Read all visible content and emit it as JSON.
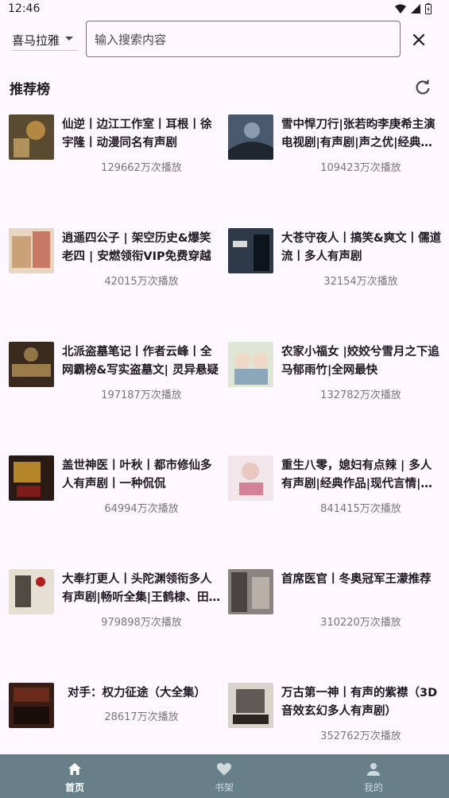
{
  "status_bar": {
    "time": "12:46"
  },
  "search": {
    "source": "喜马拉雅",
    "placeholder": "输入搜索内容"
  },
  "section": {
    "title": "推荐榜"
  },
  "books": [
    {
      "title": "仙逆丨边江工作室丨耳根丨徐宇隆丨动漫同名有声剧",
      "plays": "129662万次播放",
      "cover_color": "#5a4a2f"
    },
    {
      "title": "雪中悍刀行|张若昀李庚希主演电视剧|有声剧|声之优|经典作品",
      "plays": "109423万次播放",
      "cover_color": "#4a5a6e"
    },
    {
      "title": "逍遥四公子 | 架空历史&爆笑老四 | 安燃领衔VIP免费穿越",
      "plays": "42015万次播放",
      "cover_color": "#c9a27a"
    },
    {
      "title": "大苍守夜人丨搞笑&爽文丨儒道流丨多人有声剧",
      "plays": "32154万次播放",
      "cover_color": "#2e3a4a"
    },
    {
      "title": "北派盗墓笔记丨作者云峰丨全网霸榜&写实盗墓文| 灵异悬疑",
      "plays": "197187万次播放",
      "cover_color": "#3a2a1e"
    },
    {
      "title": "农家小福女 |姣姣兮雪月之下追马郁雨竹|全网最快",
      "plays": "132782万次播放",
      "cover_color": "#b9c9b0"
    },
    {
      "title": "盖世神医丨叶秋丨都市修仙多人有声剧丨一种侃侃",
      "plays": "64994万次播放",
      "cover_color": "#2a1a14"
    },
    {
      "title": "重生八零，媳妇有点辣 | 多人有声剧|经典作品|现代言情|甜宠",
      "plays": "841415万次播放",
      "cover_color": "#e8d8dc"
    },
    {
      "title": "大奉打更人丨头陀渊领衔多人有声剧|畅听全集|王鹤棣、田曦薇",
      "plays": "979898万次播放",
      "cover_color": "#d9d2c6"
    },
    {
      "title": "首席医官丨冬奥冠军王濛推荐",
      "plays": "310220万次播放",
      "cover_color": "#6a6460"
    },
    {
      "title": "对手：权力征途（大全集）",
      "plays": "28617万次播放",
      "cover_color": "#3a1c14"
    },
    {
      "title": "万古第一神丨有声的紫襟（3D音效玄幻多人有声剧）",
      "plays": "352762万次播放",
      "cover_color": "#5e5a56"
    }
  ],
  "nav": {
    "home": "首页",
    "shelf": "书架",
    "mine": "我的"
  }
}
